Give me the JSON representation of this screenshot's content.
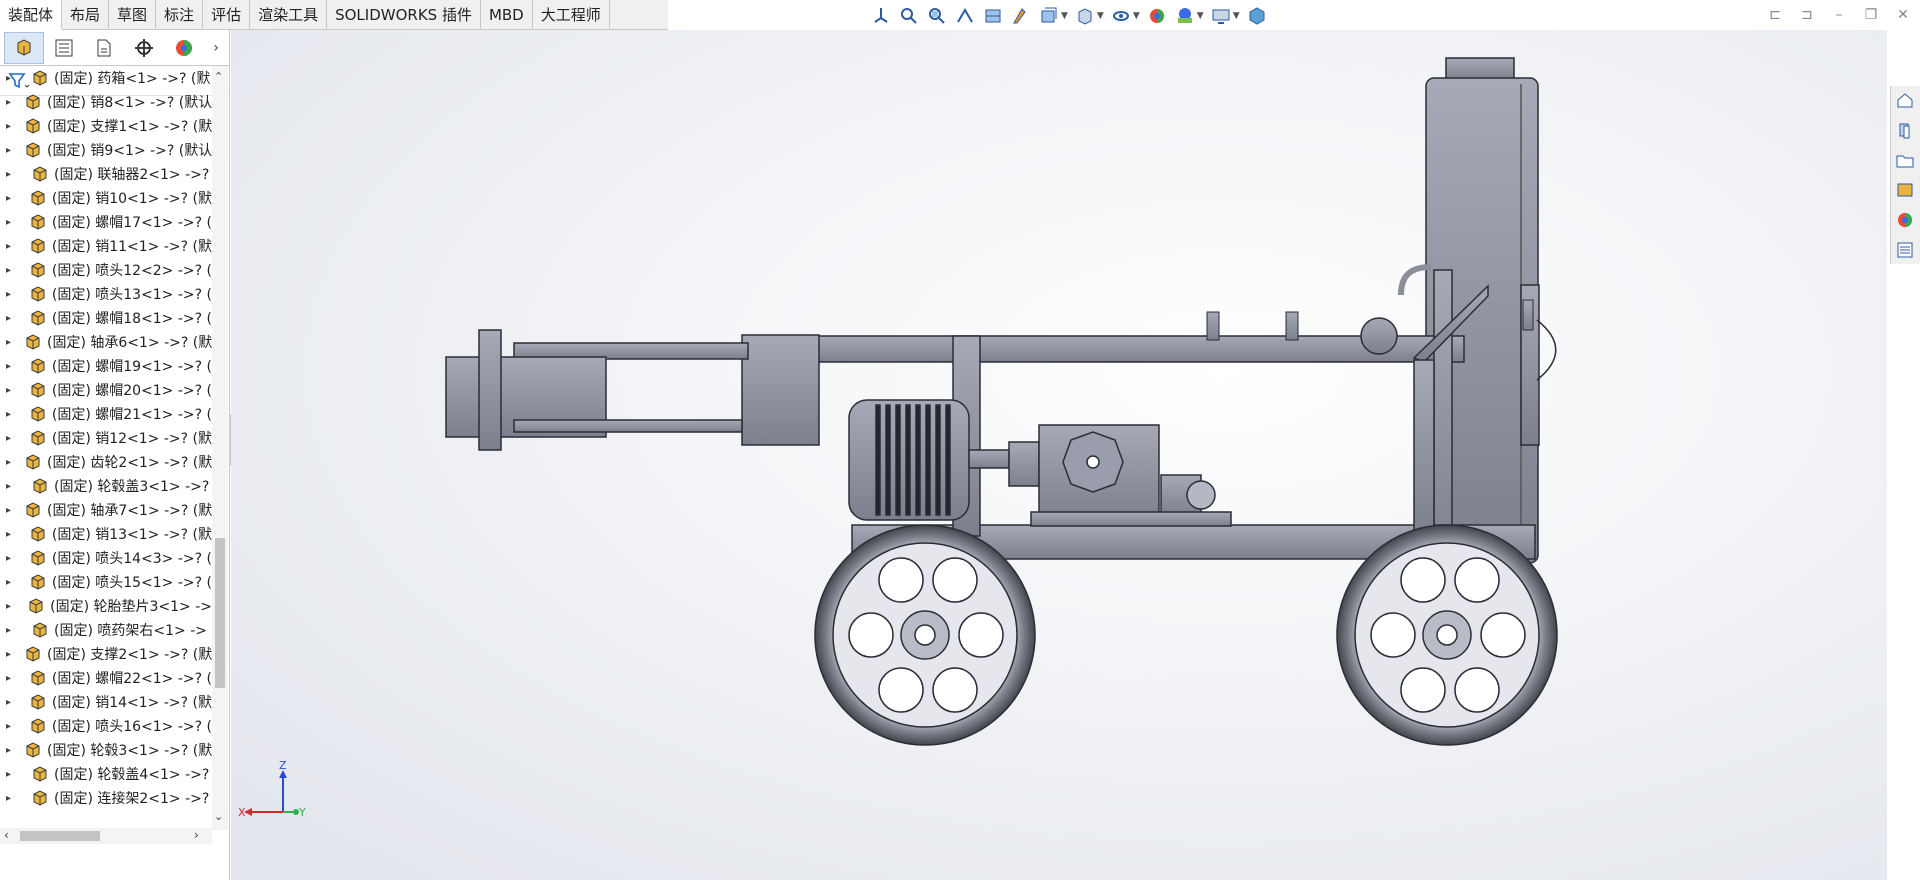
{
  "tabs": [
    {
      "label": "装配体",
      "active": true
    },
    {
      "label": "布局"
    },
    {
      "label": "草图"
    },
    {
      "label": "标注"
    },
    {
      "label": "评估"
    },
    {
      "label": "渲染工具"
    },
    {
      "label": "SOLIDWORKS 插件"
    },
    {
      "label": "MBD"
    },
    {
      "label": "大工程师"
    }
  ],
  "view_toolbar_icons": [
    "view-orientation-icon",
    "zoom-to-fit-icon",
    "zoom-area-icon",
    "previous-view-icon",
    "section-view-icon",
    "dynamic-annotation-icon",
    "view-3d-icon",
    "display-style-icon",
    "hide-show-icon",
    "edit-appearance-icon",
    "apply-scene-icon",
    "view-settings-icon",
    "display-icon"
  ],
  "panel_tabs": [
    "feature-manager-icon",
    "property-manager-icon",
    "configuration-manager-icon",
    "dimxpert-icon",
    "display-manager-icon"
  ],
  "tree": {
    "items": [
      "(固定) 药箱<1> ->? (默",
      "(固定) 销8<1> ->? (默认",
      "(固定) 支撑1<1> ->? (默",
      "(固定) 销9<1> ->? (默认",
      "(固定) 联轴器2<1> ->?",
      "(固定) 销10<1> ->? (默",
      "(固定) 螺帽17<1> ->? (",
      "(固定) 销11<1> ->? (默",
      "(固定) 喷头12<2> ->? (",
      "(固定) 喷头13<1> ->? (",
      "(固定) 螺帽18<1> ->? (",
      "(固定) 轴承6<1> ->? (默",
      "(固定) 螺帽19<1> ->? (",
      "(固定) 螺帽20<1> ->? (",
      "(固定) 螺帽21<1> ->? (",
      "(固定) 销12<1> ->? (默",
      "(固定) 齿轮2<1> ->? (默",
      "(固定) 轮毂盖3<1> ->?",
      "(固定) 轴承7<1> ->? (默",
      "(固定) 销13<1> ->? (默",
      "(固定) 喷头14<3> ->? (",
      "(固定) 喷头15<1> ->? (",
      "(固定) 轮胎垫片3<1> ->",
      "(固定) 喷药架右<1> ->",
      "(固定) 支撑2<1> ->? (默",
      "(固定) 螺帽22<1> ->? (",
      "(固定) 销14<1> ->? (默",
      "(固定) 喷头16<1> ->? (",
      "(固定) 轮毂3<1> ->? (默",
      "(固定) 轮毂盖4<1> ->?",
      "(固定) 连接架2<1> ->?"
    ]
  },
  "triad": {
    "x": "X",
    "y": "Y",
    "z": "Z"
  },
  "colors": {
    "part_icon": "#e8b640",
    "accent": "#1f6fd1",
    "model": "#8c8f9a"
  }
}
